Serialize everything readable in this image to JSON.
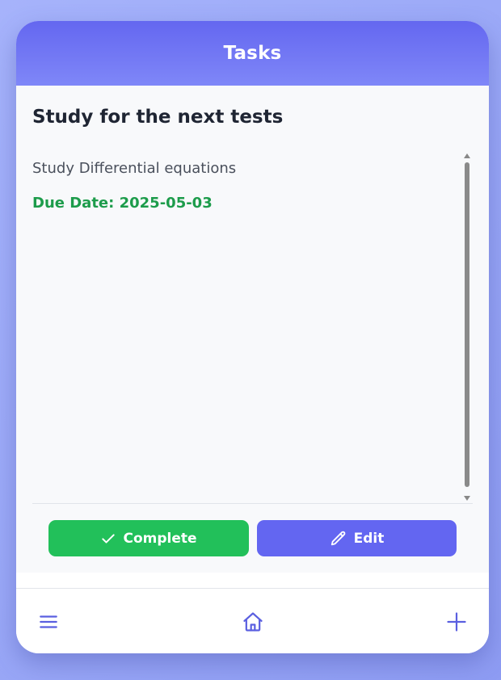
{
  "header": {
    "title": "Tasks"
  },
  "task": {
    "title": "Study for the next tests",
    "description": "Study Differential equations",
    "due_date": "Due Date: 2025-05-03"
  },
  "actions": {
    "complete_label": "Complete",
    "edit_label": "Edit"
  },
  "nav": {
    "icons": [
      "menu-icon",
      "home-icon",
      "plus-icon"
    ]
  },
  "colors": {
    "accent": "#6366f1",
    "success": "#22c05a",
    "due_text": "#1d9c4b"
  }
}
